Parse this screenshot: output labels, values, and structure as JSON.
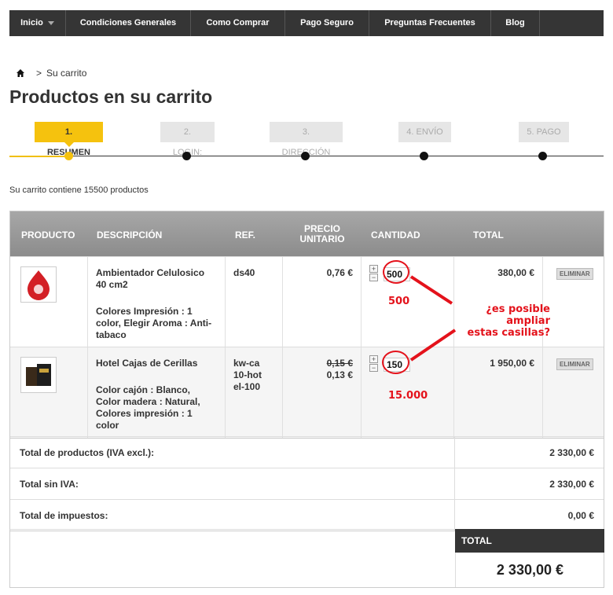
{
  "nav": {
    "items": [
      "Inicio",
      "Condiciones Generales",
      "Como Comprar",
      "Pago Seguro",
      "Preguntas Frecuentes",
      "Blog"
    ]
  },
  "breadcrumb": {
    "separator": ">",
    "current": "Su carrito"
  },
  "page_title": "Productos en su carrito",
  "steps": [
    "1. RESUMEN",
    "2. LOGIN:",
    "3. DIRECCIÓN",
    "4. ENVÍO",
    "5. PAGO"
  ],
  "cart_summary": "Su carrito contiene 15500 productos",
  "table": {
    "headers": {
      "product": "PRODUCTO",
      "description": "DESCRIPCIÓN",
      "ref": "REF.",
      "unit_price_1": "PRECIO",
      "unit_price_2": "UNITARIO",
      "quantity": "CANTIDAD",
      "total": "TOTAL"
    },
    "rows": [
      {
        "name": "Ambientador Celulosico 40 cm2",
        "attributes": "Colores Impresión : 1 color, Elegir Aroma : Anti-tabaco",
        "ref": "ds40",
        "old_price": "",
        "price": "0,76 €",
        "quantity": "500",
        "total": "380,00 €",
        "delete_label": "ELIMINAR"
      },
      {
        "name": "Hotel Cajas de Cerillas",
        "attributes": "Color cajón : Blanco, Color madera : Natural, Colores impresión : 1 color",
        "ref": "kw-ca10-hotel-100",
        "old_price": "0,15 €",
        "price": "0,13 €",
        "quantity": "150",
        "total": "1 950,00 €",
        "delete_label": "ELIMINAR"
      }
    ]
  },
  "annotations": {
    "qty1": "500",
    "question_line1": "¿es posible ampliar",
    "question_line2": "estas casillas?",
    "qty2": "15.000",
    "color": "#e4121b"
  },
  "totals": [
    {
      "label": "Total de productos (IVA excl.):",
      "value": "2 330,00 €"
    },
    {
      "label": "Total sin IVA:",
      "value": "2 330,00 €"
    },
    {
      "label": "Total de impuestos:",
      "value": "0,00 €"
    }
  ],
  "grand_total": {
    "label": "TOTAL",
    "value": "2 330,00 €"
  },
  "colors": {
    "accent": "#f5c20e",
    "nav_bg": "#353535"
  }
}
